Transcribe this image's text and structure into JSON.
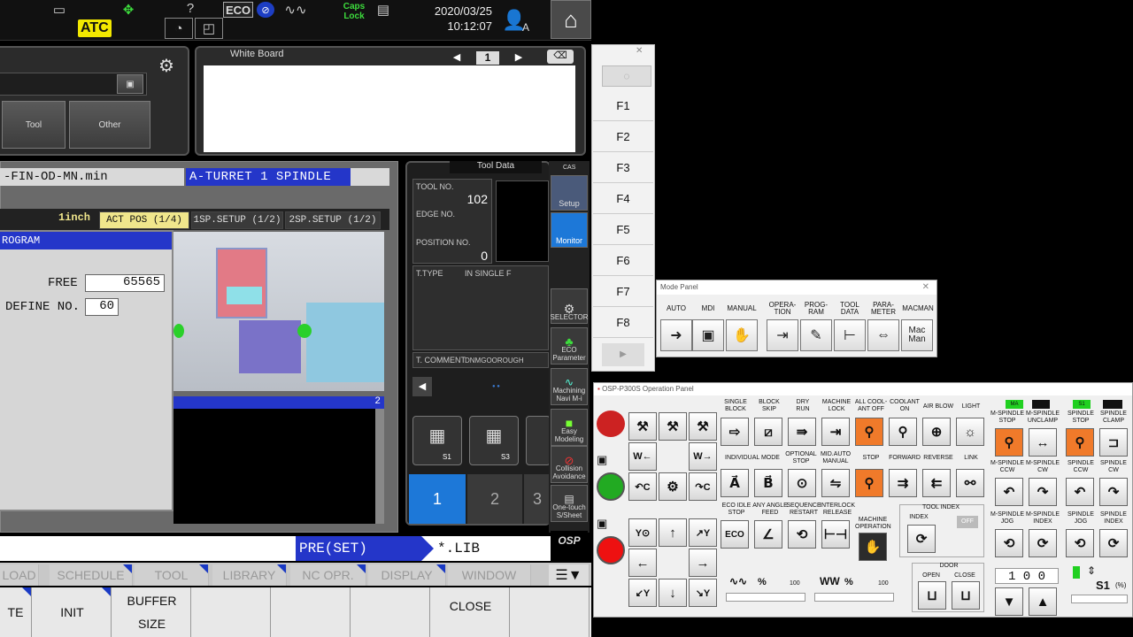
{
  "topbar": {
    "atc_label": "ATC",
    "eco_label": "ECO",
    "caps_lock_label": "Caps\nLock",
    "date": "2020/03/25",
    "time": "10:12:07",
    "user_letter": "A"
  },
  "upper_panel": {
    "buttons": [
      "Tool",
      "Other"
    ]
  },
  "whiteboard": {
    "title": "White Board",
    "page": "1"
  },
  "program": {
    "filename": "-FIN-OD-MN.min",
    "turret_label": "A-TURRET   1 SPINDLE",
    "unit": "1inch",
    "tabs": [
      "ACT POS (1/4)",
      "1SP.SETUP (1/2)",
      "2SP.SETUP (1/2)"
    ],
    "panel_title": "ROGRAM",
    "free_label": "FREE",
    "free_value": "65565",
    "define_label": "DEFINE NO.",
    "define_value": "60",
    "lower_page": "2"
  },
  "tool_data": {
    "title": "Tool Data",
    "tool_no_label": "TOOL NO.",
    "tool_no_value": "102",
    "edge_no_label": "EDGE NO.",
    "position_no_label": "POSITION NO.",
    "position_no_value": "0",
    "t_type_label": "T.TYPE",
    "t_type_value": "IN SINGLE F",
    "t_comment_label": "T. COMMENT",
    "t_comment_value": "DNMGOOROUGH",
    "icons": [
      "S1",
      "S3"
    ],
    "numbers": [
      "1",
      "2",
      "3"
    ]
  },
  "side_menu": {
    "cas_label": "CAS",
    "setup": "Setup",
    "monitor": "Monitor",
    "selector": "SELECTOR",
    "eco_param": "ECO\nParameter",
    "machining_navi": "Machining\nNavi M-i",
    "easy_modeling": "Easy\nModeling",
    "collision": "Collision\nAvoidance",
    "one_touch": "One-touch\nS/Sheet",
    "osp_label": "OSP"
  },
  "bottom": {
    "pre_set": "PRE(SET)",
    "lib": "*.LIB",
    "menu": [
      "LOAD",
      "SCHEDULE",
      "TOOL",
      "LIBRARY",
      "NC OPR.",
      "DISPLAY",
      "WINDOW"
    ],
    "softkeys": [
      "TE",
      "INIT",
      "BUFFER\nSIZE",
      "",
      "",
      "",
      "CLOSE",
      ""
    ]
  },
  "f_panel": {
    "keys": [
      "F1",
      "F2",
      "F3",
      "F4",
      "F5",
      "F6",
      "F7",
      "F8"
    ]
  },
  "mode_panel": {
    "title": "Mode Panel",
    "labels": [
      "AUTO",
      "MDI",
      "MANUAL",
      "OPERA-\nTION",
      "PROG-\nRAM",
      "TOOL\nDATA",
      "PARA-\nMETER",
      "MACMAN"
    ],
    "macman_btn": "Mac\nMan"
  },
  "op_panel": {
    "title": "OSP-P300S Operation Panel",
    "row1_labels": [
      "SINGLE\nBLOCK",
      "BLOCK\nSKIP",
      "DRY\nRUN",
      "MACHINE\nLOCK",
      "ALL COOL-\nANT OFF",
      "COOLANT\nON",
      "AIR BLOW",
      "LIGHT"
    ],
    "row2_labels": [
      "INDIVIDUAL MODE",
      "STOP",
      "FORWARD",
      "REVERSE",
      "LINK"
    ],
    "row2_extra": [
      "OPTIONAL\nSTOP",
      "MID.AUTO\nMANUAL"
    ],
    "row3_labels": [
      "ECO IDLE\nSTOP",
      "ANY ANGLE\nFEED",
      "SEQUENCE\nRESTART",
      "INTERLOCK\nRELEASE",
      "MACHINE\nOPERATION"
    ],
    "tool_index": "TOOL INDEX",
    "index": "INDEX",
    "off": "OFF",
    "door": "DOOR",
    "open": "OPEN",
    "close": "CLOSE",
    "spindle_labels": [
      "M-SPINDLE\nSTOP",
      "M-SPINDLE\nUNCLAMP",
      "SPINDLE\nSTOP",
      "SPINDLE\nCLAMP"
    ],
    "spindle_labels2": [
      "M-SPINDLE\nCCW",
      "M-SPINDLE\nCW",
      "SPINDLE\nCCW",
      "SPINDLE\nCW"
    ],
    "spindle_labels3": [
      "M-SPINDLE\nJOG",
      "M-SPINDLE\nINDEX",
      "SPINDLE\nJOG",
      "SPINDLE\nINDEX"
    ],
    "ma_tag": "MA",
    "s1_tag": "S1",
    "override_pct": [
      "%",
      "%"
    ],
    "override_100": [
      "100",
      "100"
    ],
    "spindle_override": "1 0 0",
    "s1_label": "S1",
    "pct": "(%)"
  }
}
